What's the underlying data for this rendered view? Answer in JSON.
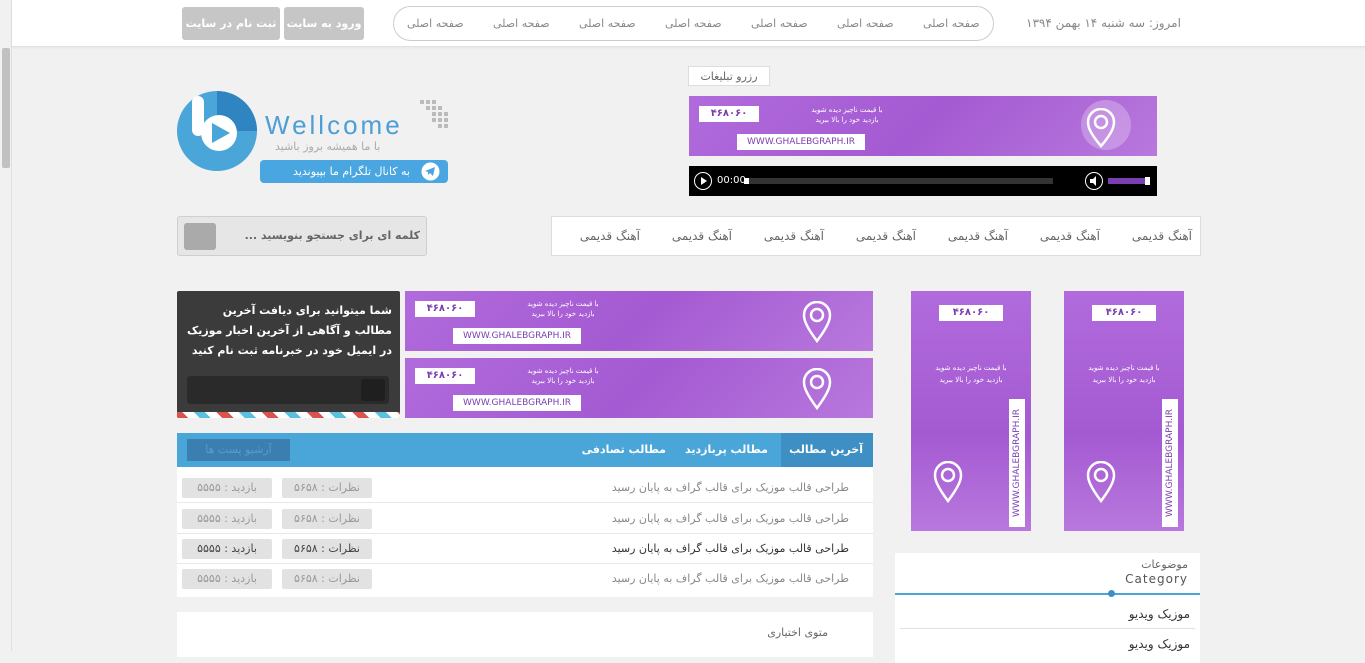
{
  "topbar": {
    "date": "امروز: سه شنبه ۱۴ بهمن ۱۳۹۴",
    "nav": [
      "صفحه اصلی",
      "صفحه اصلی",
      "صفحه اصلی",
      "صفحه اصلی",
      "صفحه اصلی",
      "صفحه اصلی",
      "صفحه اصلی"
    ],
    "login_label": "ورود به سایت",
    "register_label": "ثبت نام در سایت"
  },
  "logo": {
    "title": "Wellcome",
    "subtitle": "با ما همیشه بروز باشید",
    "telegram_label": "به کانال تلگرام ما بپیوندید"
  },
  "ads": {
    "reserve_label": "رزرو تبلیغات",
    "phone": "۴۶۸۰۶۰",
    "line1": "با قیمت ناچیز دیده شوید",
    "line2": "بازدید خود را بالا ببرید",
    "url": "WWW.GHALEBGRAPH.IR"
  },
  "audio": {
    "time": "00:00"
  },
  "search": {
    "placeholder": "کلمه ای برای جستجو بنویسید ..."
  },
  "menu": {
    "items": [
      "آهنگ قدیمی",
      "آهنگ قدیمی",
      "آهنگ قدیمی",
      "آهنگ قدیمی",
      "آهنگ قدیمی",
      "آهنگ قدیمی",
      "آهنگ قدیمی"
    ]
  },
  "newsletter": {
    "text": "شما میتوانید برای دیافت آخرین مطالب و آگاهی از آخرین اخبار موزیک در ایمیل خود در خبرنامه ثبت نام کنید"
  },
  "tabs": {
    "items": [
      "آخرین مطالب",
      "مطالب پربازدید",
      "مطالب تصادفی"
    ],
    "archive_label": "آرشیو پست ها"
  },
  "posts": [
    {
      "title": "طراحی قالب موزیک برای قالب گراف به پایان رسید",
      "comments": "نظرات : ۵۶۵۸",
      "views": "بازدید : ۵۵۵۵"
    },
    {
      "title": "طراحی قالب موزیک برای قالب گراف به پایان رسید",
      "comments": "نظرات : ۵۶۵۸",
      "views": "بازدید : ۵۵۵۵"
    },
    {
      "title": "طراحی قالب موزیک برای قالب گراف به پایان رسید",
      "comments": "نظرات : ۵۶۵۸",
      "views": "بازدید : ۵۵۵۵"
    },
    {
      "title": "طراحی قالب موزیک برای قالب گراف به پایان رسید",
      "comments": "نظرات : ۵۶۵۸",
      "views": "بازدید : ۵۵۵۵"
    }
  ],
  "optional": {
    "label": "متوی اختیاری"
  },
  "category": {
    "title_fa": "موضوعات",
    "title_en": "Category",
    "items": [
      "موزیک ویدیو",
      "موزیک ویدیو"
    ]
  },
  "colors": {
    "accent": "#4aa6d8",
    "banner": "#a45ad2"
  }
}
